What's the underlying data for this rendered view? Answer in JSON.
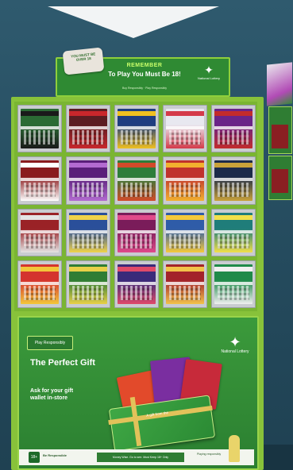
{
  "header": {
    "hand_text": "YOU MUST BE OVER 18",
    "title": "REMEMBER",
    "subtitle": "To Play You Must Be 18!",
    "small_print": "Buy Responsibly · Play Responsibly",
    "logo_glyph": "✦",
    "logo_text": "National Lottery"
  },
  "tickets": [
    {
      "head": "",
      "c1": "#2b6b34",
      "c2": "#1a1a1a"
    },
    {
      "head": "",
      "c1": "#5b1d22",
      "c2": "#c9272c"
    },
    {
      "head": "",
      "c1": "#1f3d80",
      "c2": "#f0c020"
    },
    {
      "head": "",
      "c1": "#e8e8f0",
      "c2": "#d43a4a"
    },
    {
      "head": "",
      "c1": "#6a2488",
      "c2": "#c32b2b"
    },
    {
      "head": "",
      "c1": "#8a1b1e",
      "c2": "#ffffff"
    },
    {
      "head": "",
      "c1": "#5a1f7a",
      "c2": "#b36bd1"
    },
    {
      "head": "",
      "c1": "#2d7d3a",
      "c2": "#d34a2a"
    },
    {
      "head": "",
      "c1": "#c0322c",
      "c2": "#f2b12e"
    },
    {
      "head": "",
      "c1": "#1c2a4a",
      "c2": "#c9a23a"
    },
    {
      "head": "",
      "c1": "#9a2226",
      "c2": "#e4e4e4"
    },
    {
      "head": "",
      "c1": "#2a4f9a",
      "c2": "#f0d34a"
    },
    {
      "head": "",
      "c1": "#7a1c5a",
      "c2": "#e04a8a"
    },
    {
      "head": "",
      "c1": "#2f5ca8",
      "c2": "#f5c93a"
    },
    {
      "head": "",
      "c1": "#1f7d7a",
      "c2": "#f2e04a"
    },
    {
      "head": "",
      "c1": "#d4342e",
      "c2": "#f2c63a"
    },
    {
      "head": "",
      "c1": "#2f7d34",
      "c2": "#e8d048"
    },
    {
      "head": "",
      "c1": "#3a2a7a",
      "c2": "#e04a6a"
    },
    {
      "head": "",
      "c1": "#a3232a",
      "c2": "#f2c24a"
    },
    {
      "head": "",
      "c1": "#1f8a4a",
      "c2": "#f0f0f0"
    }
  ],
  "panel": {
    "badge": "Play Responsibly",
    "headline": "The Perfect Gift",
    "ask": "Ask for your gift wallet in-store",
    "logo_glyph": "✦",
    "logo_text": "National Lottery",
    "giftcard_text": "A gift from the",
    "bottom_badge": "18+",
    "bottom_text": "Be Responsible",
    "bottom_mid": "Money Wise. Go to see. Must Keep 18+ Only",
    "bottom_right": "Playing responsibly"
  },
  "colors": {
    "background": "#2a5266",
    "cabinet": "#88c23a",
    "panel": "#3b9a3b",
    "header": "#2f8a33"
  }
}
